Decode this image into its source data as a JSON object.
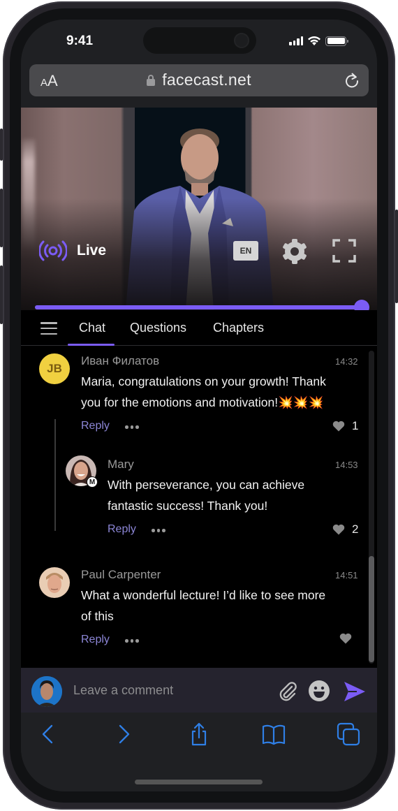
{
  "status_bar": {
    "time": "9:41",
    "icons": [
      "cellular-signal-icon",
      "wifi-icon",
      "battery-icon"
    ]
  },
  "browser": {
    "text_size_label_small": "A",
    "text_size_label_large": "A",
    "url": "facecast.net",
    "secure": true,
    "icons": [
      "lock-icon",
      "reload-icon"
    ]
  },
  "player": {
    "live_label": "Live",
    "language": "EN",
    "progress_percent": 100,
    "accent_color": "#7b5cf5",
    "icons": [
      "live-broadcast-icon",
      "gear-icon",
      "fullscreen-icon"
    ]
  },
  "tabs": {
    "items": [
      {
        "label": "Chat",
        "active": true
      },
      {
        "label": "Questions",
        "active": false
      },
      {
        "label": "Chapters",
        "active": false
      }
    ]
  },
  "comments": [
    {
      "author": "Иван Филатов",
      "initials": "JB",
      "time": "14:32",
      "text_line1": "Maria, congratulations on your growth! Thank",
      "text_line2": "you for the emotions and motivation!💥💥💥",
      "reply_label": "Reply",
      "likes": "1",
      "replies": [
        {
          "author": "Mary",
          "badge": "M",
          "time": "14:53",
          "text_line1": "With perseverance, you can achieve",
          "text_line2": "fantastic success! Thank you!",
          "reply_label": "Reply",
          "likes": "2"
        }
      ]
    },
    {
      "author": "Paul Carpenter",
      "time": "14:51",
      "text_line1": "What a wonderful lecture!  I’d like to see more",
      "text_line2": "of this",
      "reply_label": "Reply",
      "likes": ""
    }
  ],
  "composer": {
    "placeholder": "Leave a comment",
    "value": "",
    "icons": [
      "paperclip-icon",
      "emoji-icon",
      "send-icon"
    ]
  },
  "safari_toolbar": {
    "icons": [
      "back-icon",
      "forward-icon",
      "share-icon",
      "bookmarks-icon",
      "tabs-icon"
    ],
    "tint_color": "#2f7fe6"
  }
}
